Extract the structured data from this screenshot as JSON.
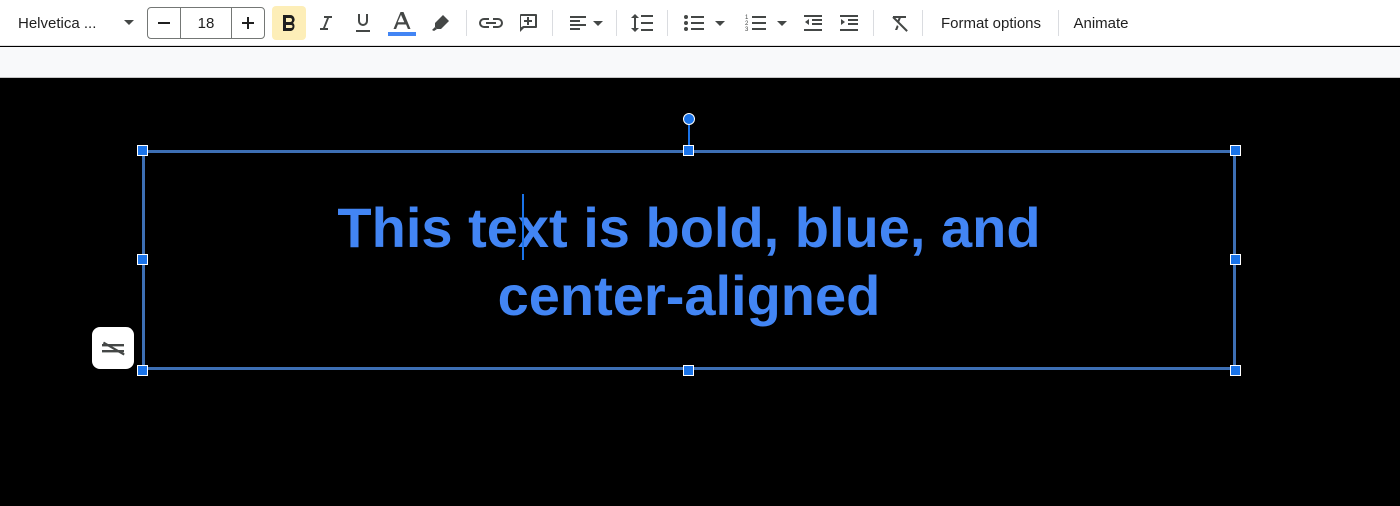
{
  "toolbar": {
    "font_name": "Helvetica ...",
    "font_size": "18",
    "format_options_label": "Format options",
    "animate_label": "Animate",
    "icons": [
      "chevron-down-icon",
      "minus-icon",
      "plus-icon",
      "bold-icon",
      "italic-icon",
      "underline-icon",
      "text-color-icon",
      "highlight-icon",
      "link-icon",
      "add-comment-icon",
      "align-icon",
      "line-spacing-icon",
      "bulleted-list-icon",
      "numbered-list-icon",
      "decrease-indent-icon",
      "increase-indent-icon",
      "clear-formatting-icon"
    ],
    "text_color": "#4285f4",
    "bold_active_bg": "#fdeeb8"
  },
  "canvas": {
    "text_line_1": "This text is bold, blue, and",
    "text_line_2": "center-aligned",
    "text_color": "#4285f4",
    "selection_color": "#1a73e8"
  }
}
